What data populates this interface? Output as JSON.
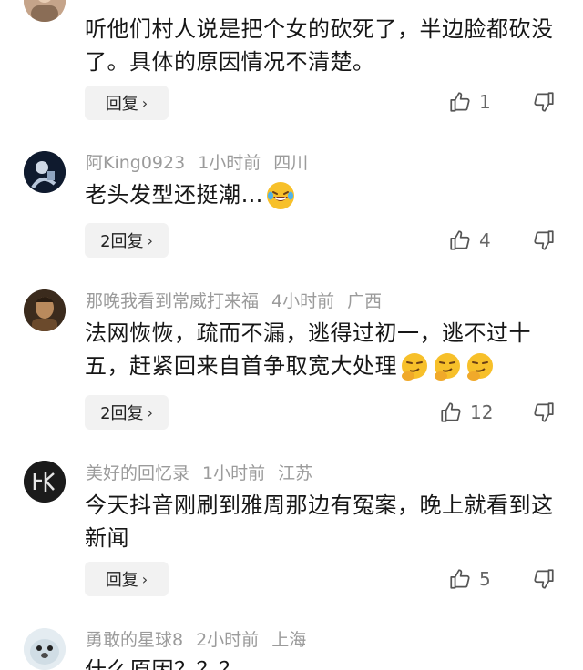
{
  "comments": [
    {
      "username": "",
      "time": "",
      "location": "",
      "text": "听他们村人说是把个女的砍死了，半边脸都砍没了。具体的原因情况不清楚。",
      "reply_label": "回复",
      "likes": "1"
    },
    {
      "username": "阿King0923",
      "time": "1小时前",
      "location": "四川",
      "text": "老头发型还挺潮…",
      "reply_label": "2回复",
      "likes": "4"
    },
    {
      "username": "那晚我看到常威打来福",
      "time": "4小时前",
      "location": "广西",
      "text": "法网恢恢，疏而不漏，逃得过初一，逃不过十五，赶紧回来自首争取宽大处理",
      "reply_label": "2回复",
      "likes": "12"
    },
    {
      "username": "美好的回忆录",
      "time": "1小时前",
      "location": "江苏",
      "text": "今天抖音刚刷到雅周那边有冤案，晚上就看到这新闻",
      "reply_label": "回复",
      "likes": "5"
    },
    {
      "username": "勇敢的星球8",
      "time": "2小时前",
      "location": "上海",
      "text": "什么原因？？？"
    }
  ],
  "colors": {
    "meta": "#9b9b9b",
    "text": "#161616",
    "reply_bg": "#f2f2f2",
    "icon": "#555555"
  }
}
